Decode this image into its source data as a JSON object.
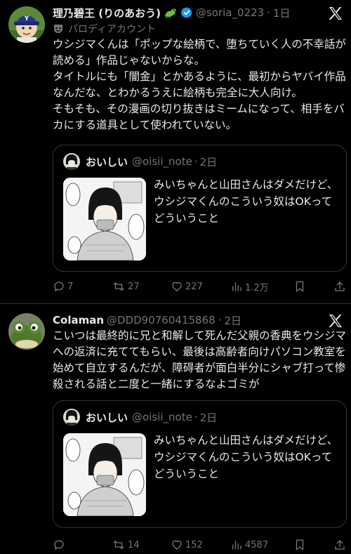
{
  "tweets": [
    {
      "author_name": "理乃碧王 (りのあおう)",
      "handle": "@soria_0223",
      "time": "1日",
      "parody_label": "パロディアカウント",
      "text": "ウシジマくんは「ポップな絵柄で、堕ちていく人の不幸話が読める」作品じゃないからな。\nタイトルにも「闇金」とかあるように、最初からヤバイ作品なんだな、とわかるうえに絵柄も完全に大人向け。\nそもそも、その漫画の切り抜きはミームになって、相手をバカにする道具として使われていない。",
      "quote": {
        "author_name": "おいしい",
        "handle": "@oisii_note",
        "time": "2日",
        "text": "みいちゃんと山田さんはダメだけど、ウシジマくんのこういう奴はOKってどういうこと"
      },
      "stats": {
        "replies": "7",
        "reposts": "27",
        "likes": "227",
        "views": "1.2万"
      }
    },
    {
      "author_name": "Colaman",
      "handle": "@DDD90760415868",
      "time": "2日",
      "text": "こいつは最終的に兄と和解して死んだ父親の香典をウシジマへの返済に充ててもらい、最後は高齢者向けパソコン教室を始めて自立するんだが、障碍者が面白半分にシャブ打って惨殺される話と二度と一緒にするなよゴミが",
      "quote": {
        "author_name": "おいしい",
        "handle": "@oisii_note",
        "time": "2日",
        "text": "みいちゃんと山田さんはダメだけど、ウシジマくんのこういう奴はOKってどういうこと"
      },
      "stats": {
        "replies": "",
        "reposts": "14",
        "likes": "152",
        "views": "4587"
      }
    }
  ],
  "colors": {
    "background": "#000000",
    "text": "#e7e9ea",
    "muted": "#71767b",
    "verified": "#1d9bf0",
    "border": "#2f3336"
  }
}
